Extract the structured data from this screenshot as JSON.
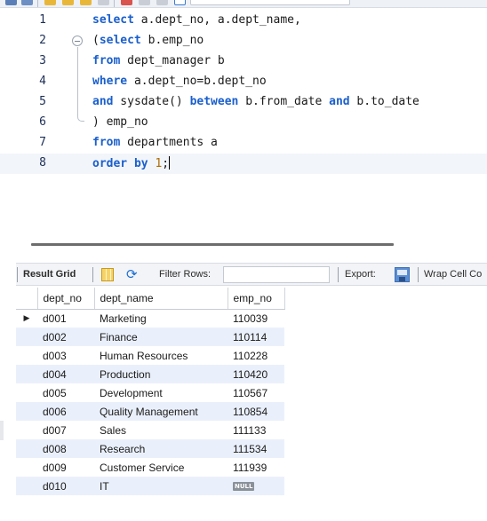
{
  "editor": {
    "lines": [
      {
        "num": "1",
        "tokens": [
          {
            "t": "select",
            "k": "kw"
          },
          {
            "t": " a.dept_no, a.dept_name,",
            "k": "plain"
          }
        ]
      },
      {
        "num": "2",
        "tokens": [
          {
            "t": "(",
            "k": "plain"
          },
          {
            "t": "select",
            "k": "kw"
          },
          {
            "t": " b.emp_no",
            "k": "plain"
          }
        ]
      },
      {
        "num": "3",
        "tokens": [
          {
            "t": "from",
            "k": "kw"
          },
          {
            "t": " dept_manager b",
            "k": "plain"
          }
        ]
      },
      {
        "num": "4",
        "tokens": [
          {
            "t": "where",
            "k": "kw"
          },
          {
            "t": " a.dept_no=b.dept_no",
            "k": "plain"
          }
        ]
      },
      {
        "num": "5",
        "tokens": [
          {
            "t": "and",
            "k": "kw"
          },
          {
            "t": " sysdate() ",
            "k": "plain"
          },
          {
            "t": "between",
            "k": "kw"
          },
          {
            "t": " b.from_date ",
            "k": "plain"
          },
          {
            "t": "and",
            "k": "kw"
          },
          {
            "t": " b.to_date",
            "k": "plain"
          }
        ]
      },
      {
        "num": "6",
        "tokens": [
          {
            "t": ") emp_no",
            "k": "plain"
          }
        ]
      },
      {
        "num": "7",
        "tokens": [
          {
            "t": "from",
            "k": "kw"
          },
          {
            "t": " departments a",
            "k": "plain"
          }
        ]
      },
      {
        "num": "8",
        "tokens": [
          {
            "t": "order",
            "k": "kw"
          },
          {
            "t": " ",
            "k": "plain"
          },
          {
            "t": "by",
            "k": "kw"
          },
          {
            "t": " ",
            "k": "plain"
          },
          {
            "t": "1",
            "k": "num"
          },
          {
            "t": ";",
            "k": "plain"
          }
        ]
      }
    ]
  },
  "result_toolbar": {
    "result_grid_label": "Result Grid",
    "filter_label": "Filter Rows:",
    "filter_value": "",
    "export_label": "Export:",
    "wrap_label": "Wrap Cell Co"
  },
  "grid": {
    "columns": [
      "dept_no",
      "dept_name",
      "emp_no"
    ],
    "null_label": "NULL",
    "rows": [
      {
        "dept_no": "d001",
        "dept_name": "Marketing",
        "emp_no": "110039",
        "current": true
      },
      {
        "dept_no": "d002",
        "dept_name": "Finance",
        "emp_no": "110114"
      },
      {
        "dept_no": "d003",
        "dept_name": "Human Resources",
        "emp_no": "110228"
      },
      {
        "dept_no": "d004",
        "dept_name": "Production",
        "emp_no": "110420"
      },
      {
        "dept_no": "d005",
        "dept_name": "Development",
        "emp_no": "110567"
      },
      {
        "dept_no": "d006",
        "dept_name": "Quality Management",
        "emp_no": "110854"
      },
      {
        "dept_no": "d007",
        "dept_name": "Sales",
        "emp_no": "111133"
      },
      {
        "dept_no": "d008",
        "dept_name": "Research",
        "emp_no": "111534"
      },
      {
        "dept_no": "d009",
        "dept_name": "Customer Service",
        "emp_no": "111939"
      },
      {
        "dept_no": "d010",
        "dept_name": "IT",
        "emp_no": null
      }
    ]
  },
  "colors": {
    "keyword": "#1a5fcc",
    "number": "#b06b00",
    "row_alt": "#eaf0fb"
  }
}
